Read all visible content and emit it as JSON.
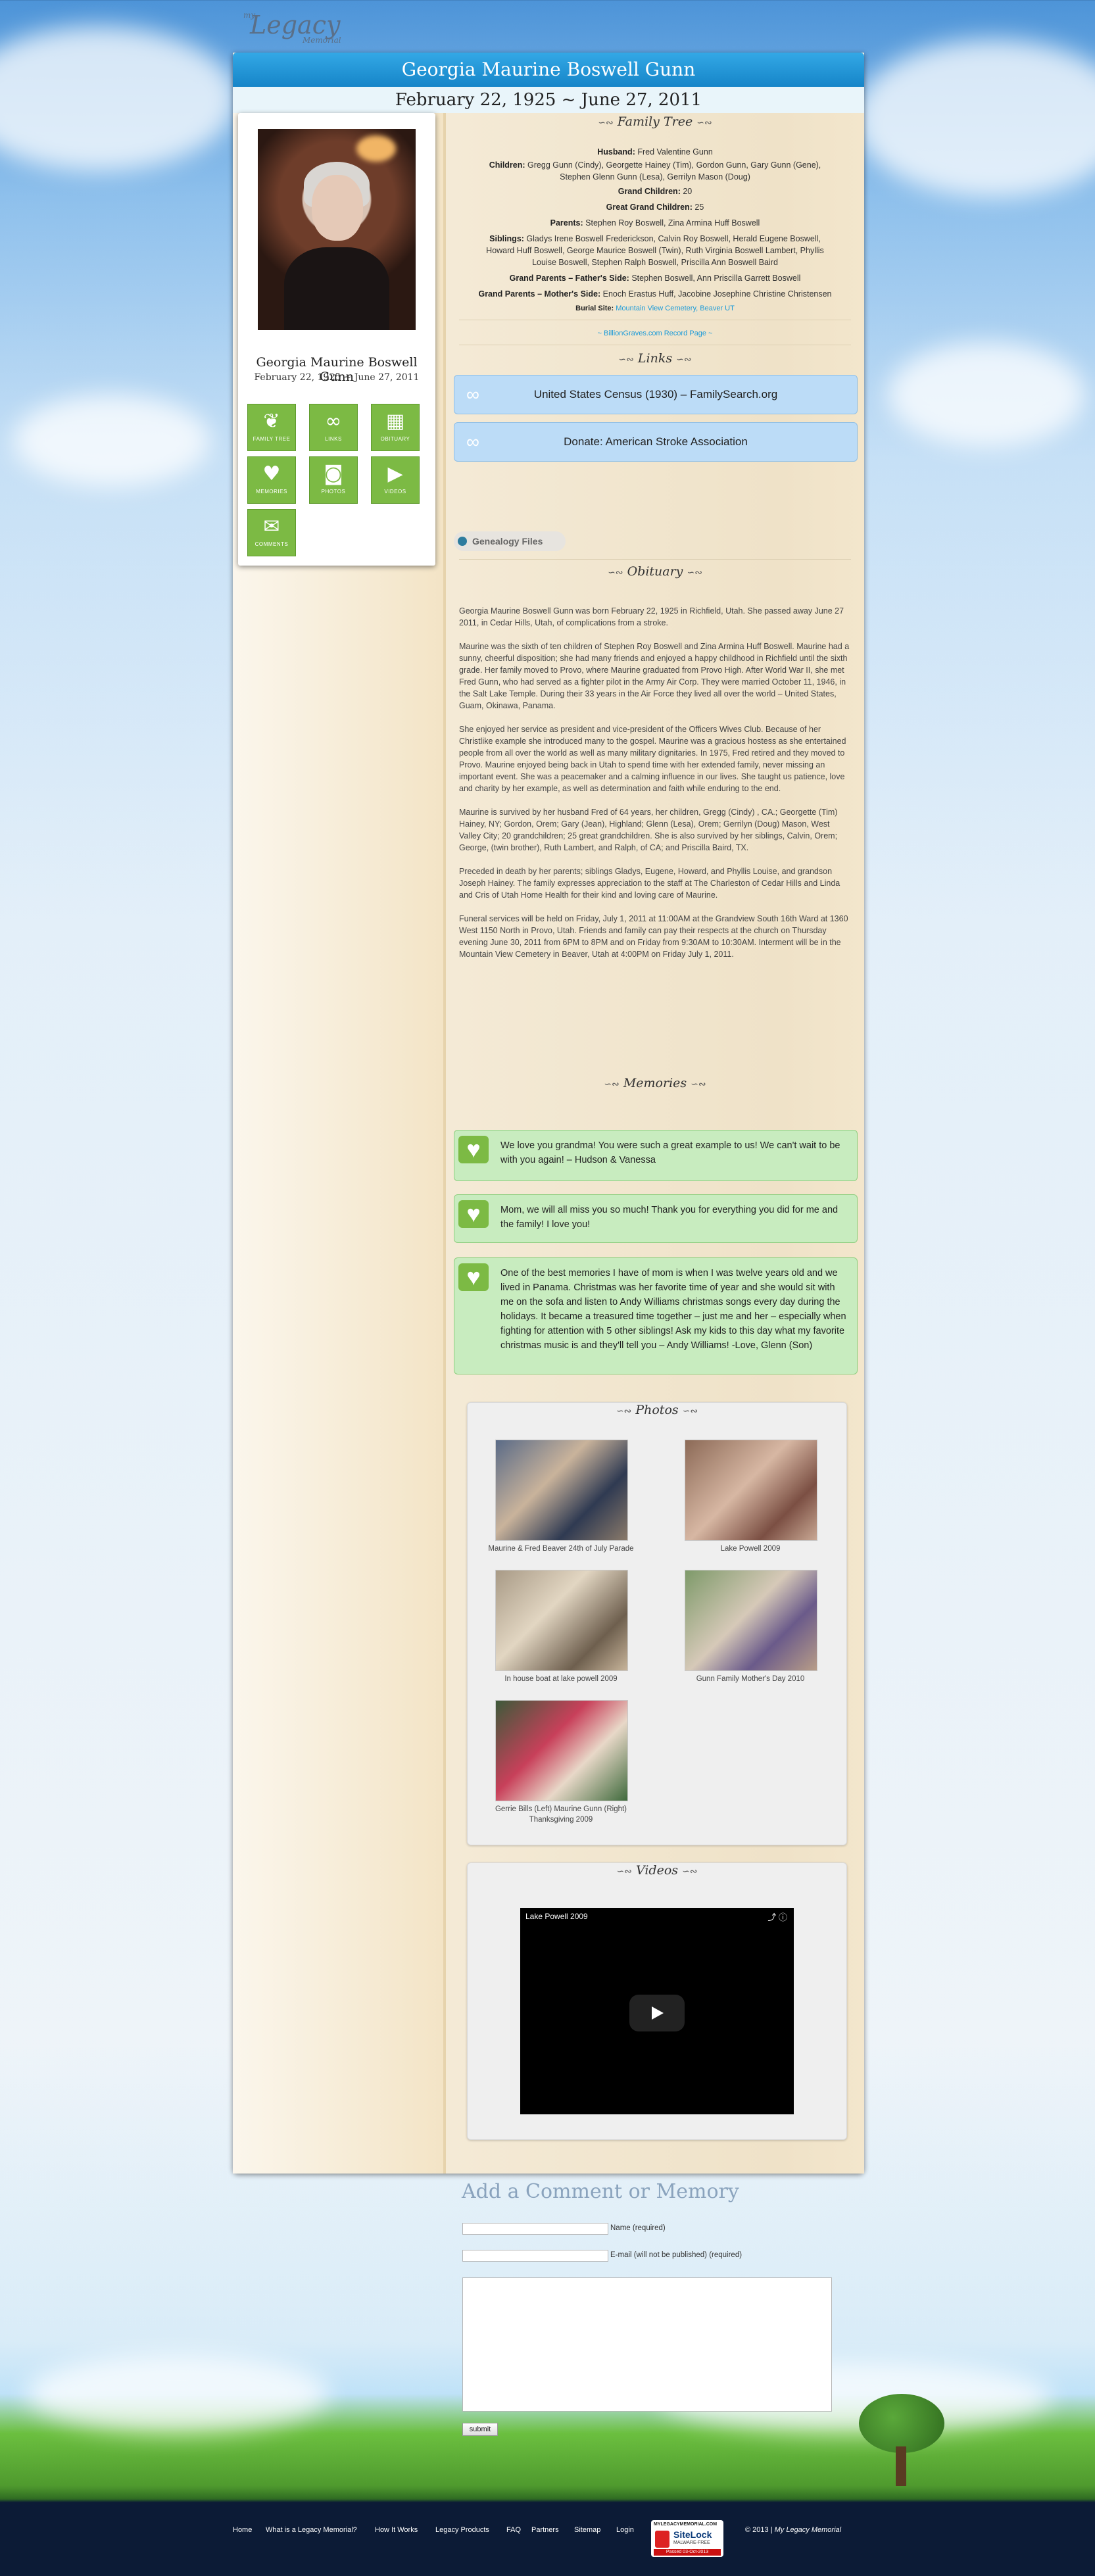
{
  "logo": {
    "small": "my",
    "big": "Legacy",
    "sub": "Memorial"
  },
  "header": {
    "name": "Georgia Maurine Boswell Gunn",
    "dates": "February 22, 1925 ~ June 27, 2011"
  },
  "profile": {
    "name": "Georgia Maurine Boswell Gunn",
    "dates": "February 22, 1925 ~ June 27, 2011",
    "buttons": [
      {
        "label": "FAMILY TREE",
        "icon": "family-tree-icon"
      },
      {
        "label": "LINKS",
        "icon": "link-icon"
      },
      {
        "label": "OBITUARY",
        "icon": "obituary-icon"
      },
      {
        "label": "MEMORIES",
        "icon": "heart-icon"
      },
      {
        "label": "PHOTOS",
        "icon": "camera-icon"
      },
      {
        "label": "VIDEOS",
        "icon": "video-camera-icon"
      },
      {
        "label": "COMMENTS",
        "icon": "comment-icon"
      }
    ]
  },
  "family_tree": {
    "title": "Family Tree",
    "husband_label": "Husband:",
    "husband": "Fred Valentine Gunn",
    "children_label": "Children:",
    "children_1": "Gregg Gunn (Cindy), Georgette Hainey (Tim), Gordon Gunn, Gary Gunn (Gene),",
    "children_2": "Stephen Glenn Gunn (Lesa), Gerrilyn Mason (Doug)",
    "grandchildren_label": "Grand Children:",
    "grandchildren": "20",
    "great_grandchildren_label": "Great Grand Children:",
    "great_grandchildren": "25",
    "parents_label": "Parents:",
    "parents": "Stephen Roy Boswell, Zina Armina Huff Boswell",
    "siblings_label": "Siblings:",
    "siblings_1": "Gladys Irene Boswell Frederickson, Calvin Roy Boswell, Herald Eugene Boswell,",
    "siblings_2": "Howard Huff Boswell, George Maurice Boswell (Twin), Ruth Virginia Boswell Lambert, Phyllis",
    "siblings_3": "Louise Boswell, Stephen Ralph Boswell, Priscilla Ann Boswell Baird",
    "gp_father_label": "Grand Parents – Father's Side:",
    "gp_father": "Stephen Boswell, Ann Priscilla Garrett Boswell",
    "gp_mother_label": "Grand Parents – Mother's Side:",
    "gp_mother": "Enoch Erastus Huff, Jacobine Josephine Christine Christensen",
    "burial_label": "Burial Site:",
    "burial": "Mountain View Cemetery, Beaver UT",
    "record_link": "~ BillionGraves.com Record Page ~"
  },
  "links": {
    "title": "Links",
    "items": [
      "United States Census (1930) – FamilySearch.org",
      "Donate: American Stroke Association"
    ],
    "genealogy": "Genealogy Files"
  },
  "obituary": {
    "title": "Obituary",
    "paragraphs": [
      "Georgia Maurine Boswell Gunn was born February 22, 1925 in Richfield, Utah. She passed away June 27 2011, in Cedar Hills, Utah, of complications from a stroke.",
      "Maurine was the sixth of ten children of Stephen Roy Boswell and Zina Armina Huff Boswell. Maurine had a sunny, cheerful disposition; she had many friends and enjoyed a happy childhood in Richfield until the sixth grade. Her family moved to Provo, where Maurine graduated from Provo High. After World War II, she met Fred Gunn, who had served as a fighter pilot in the Army Air Corp. They were married October 11, 1946, in the Salt Lake Temple. During their 33 years in the Air Force they lived all over the world – United States, Guam, Okinawa, Panama.",
      "She enjoyed her service as president and vice-president of the Officers Wives Club. Because of her Christlike example she introduced many to the gospel. Maurine was a gracious hostess as she entertained people from all over the world as well as many military dignitaries. In 1975, Fred retired and they moved to Provo. Maurine enjoyed being back in Utah to spend time with her extended family, never missing an important event. She was a peacemaker and a calming influence in our lives. She taught us patience, love and charity by her example, as well as determination and faith while enduring to the end.",
      "Maurine is survived by her husband Fred of 64 years, her children, Gregg (Cindy) , CA.; Georgette (Tim) Hainey, NY; Gordon, Orem; Gary (Jean), Highland; Glenn (Lesa), Orem; Gerrilyn (Doug) Mason, West Valley City; 20 grandchildren; 25 great grandchildren. She is also survived by her siblings, Calvin, Orem; George, (twin brother), Ruth Lambert, and Ralph, of CA; and Priscilla Baird, TX.",
      "Preceded in death by her parents; siblings Gladys, Eugene, Howard, and Phyllis Louise, and grandson Joseph Hainey. The family expresses appreciation to the staff at The Charleston of Cedar Hills and Linda and Cris of Utah Home Health for their kind and loving care of Maurine.",
      "Funeral services will be held on Friday, July 1, 2011 at 11:00AM at the Grandview South 16th Ward at 1360 West 1150 North in Provo, Utah. Friends and family can pay their respects at the church on Thursday evening June 30, 2011 from 6PM to 8PM and on Friday from 9:30AM to 10:30AM. Interment will be in the Mountain View Cemetery in Beaver, Utah at 4:00PM on Friday July 1, 2011."
    ]
  },
  "memories": {
    "title": "Memories",
    "items": [
      "We love you grandma! You were such a great example to us! We can't wait to be with you again! – Hudson & Vanessa",
      "Mom, we will all miss you so much! Thank you for everything you did for me and the family! I love you!",
      "One of the best memories I have of mom is when I was twelve years old and we lived in Panama. Christmas was her favorite time of year and she would sit with me on the sofa and listen to Andy Williams christmas songs every day during the holidays. It became a treasured time together – just me and her – especially when fighting for attention with 5 other siblings! Ask my kids to this day what my favorite christmas music is and they'll tell you – Andy Williams! -Love, Glenn (Son)"
    ]
  },
  "photos": {
    "title": "Photos",
    "captions": [
      "Maurine & Fred Beaver 24th of July Parade",
      "Lake Powell 2009",
      "In house boat at lake powell 2009",
      "Gunn Family Mother's Day 2010",
      "Gerrie Bills (Left) Maurine Gunn (Right) Thanksgiving 2009"
    ]
  },
  "videos": {
    "title": "Videos",
    "video_title": "Lake Powell 2009"
  },
  "comment_form": {
    "title": "Add a Comment or Memory",
    "name_label": "Name (required)",
    "email_label": "E-mail (will not be published) (required)",
    "submit": "submit"
  },
  "footer": {
    "nav": [
      "Home",
      "What is a Legacy Memorial?",
      "How It Works",
      "Legacy Products",
      "FAQ",
      "Partners",
      "Sitemap",
      "Login"
    ],
    "sitelock": {
      "site": "MYLEGACYMEMORIAL.COM",
      "brand": "SiteLock",
      "sub": "MALWARE-FREE",
      "passed": "Passed  03-Oct-2013"
    },
    "copyright": "© 2013 |",
    "copyright_name": "My Legacy Memorial"
  }
}
